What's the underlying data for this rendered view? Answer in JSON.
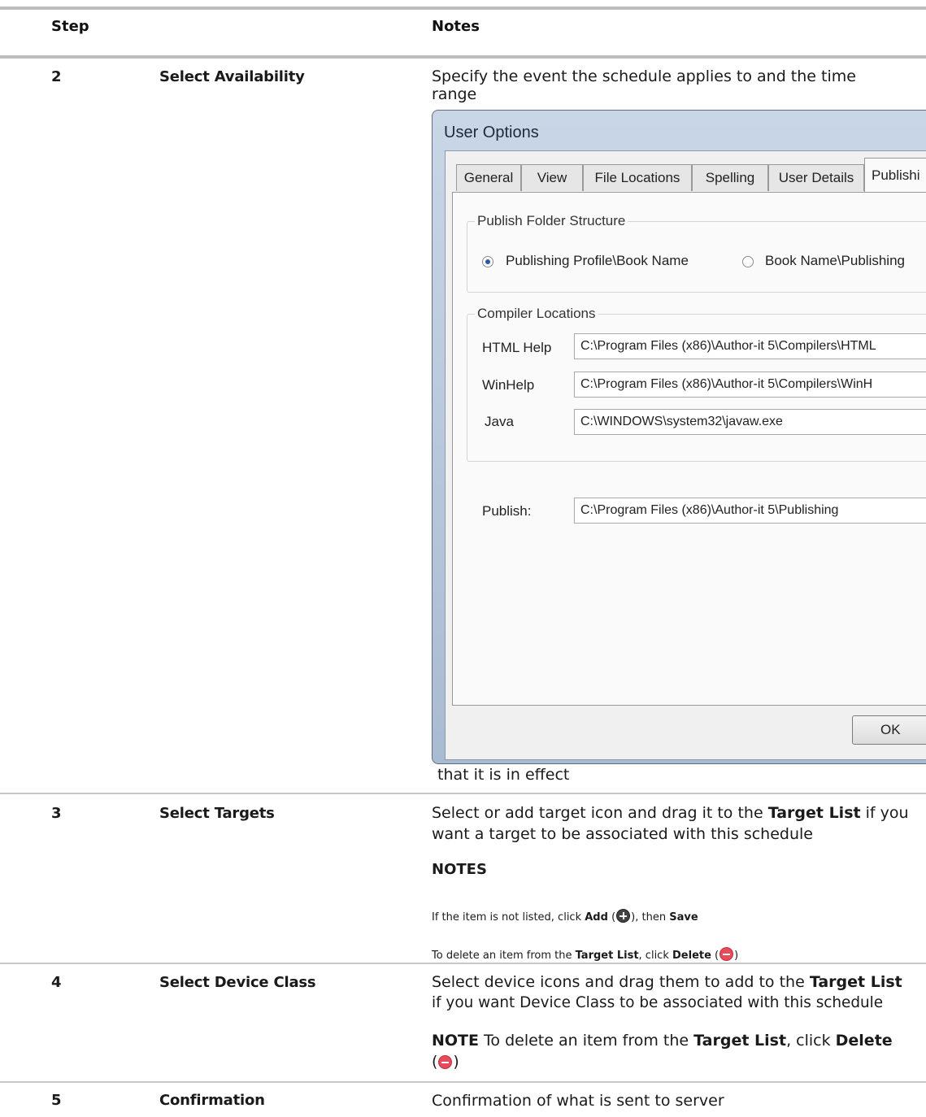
{
  "table": {
    "headers": {
      "step": "Step",
      "notes": "Notes"
    },
    "rows": [
      {
        "num": "2",
        "title": "Select Availability",
        "note_line1": "Specify the event the schedule applies to and the time",
        "note_line2": "range",
        "note_after": "that it is in effect"
      },
      {
        "num": "3",
        "title": "Select Targets",
        "note_pre": "Select or add target icon and drag it to the ",
        "note_bold": "Target List",
        "note_post": " if you",
        "note_line2": "want a target to be associated with this schedule",
        "notes_heading": "NOTES",
        "note_a_pre": "If the item is not listed, click ",
        "note_a_add": "Add",
        "note_a_mid": "), then ",
        "note_a_save": "Save",
        "note_b_pre": "To delete an item from the ",
        "note_b_target": "Target List",
        "note_b_mid": ", click ",
        "note_b_delete": "Delete"
      },
      {
        "num": "4",
        "title": "Select Device Class",
        "note_pre": "Select device icons and drag them to add to the ",
        "note_bold": "Target List",
        "note_line2": "if you want Device Class to be associated with this schedule",
        "note_label": "NOTE",
        "note2_pre": "  To delete an item from the ",
        "note2_target": "Target List",
        "note2_mid": ", click ",
        "note2_delete": "Delete"
      },
      {
        "num": "5",
        "title": "Confirmation",
        "note": "Confirmation of what is sent to server"
      }
    ]
  },
  "dialog": {
    "title": "User Options",
    "tabs": [
      "General",
      "View",
      "File Locations",
      "Spelling",
      "User Details",
      "Publishi"
    ],
    "publish_folder": {
      "label": "Publish Folder Structure",
      "option1": "Publishing Profile\\Book Name",
      "option2": "Book Name\\Publishing"
    },
    "compiler": {
      "label": "Compiler Locations",
      "html_help_label": "HTML Help",
      "html_help_value": "C:\\Program Files (x86)\\Author-it 5\\Compilers\\HTML",
      "winhelp_label": "WinHelp",
      "winhelp_value": "C:\\Program Files (x86)\\Author-it 5\\Compilers\\WinH",
      "java_label": "Java",
      "java_value": "C:\\WINDOWS\\system32\\javaw.exe"
    },
    "publish_label": "Publish:",
    "publish_value": "C:\\Program Files (x86)\\Author-it 5\\Publishing",
    "ok_label": "OK"
  }
}
